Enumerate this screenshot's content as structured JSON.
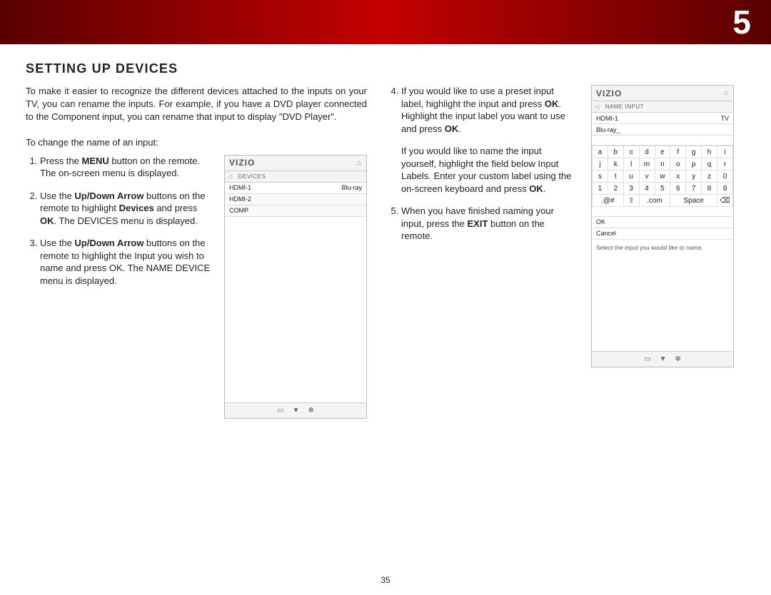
{
  "chapter_number": "5",
  "title": "SETTING UP DEVICES",
  "intro": "To make it easier to recognize the different devices attached to the inputs on your TV, you can rename the inputs. For example, if you have a DVD player connected to the Component input, you can rename that input to display \"DVD Player\".",
  "lead": "To change the name of an input:",
  "steps_left": {
    "s1a": "Press the ",
    "s1b": "MENU",
    "s1c": " button on the remote. The on-screen menu is displayed.",
    "s2a": "Use the ",
    "s2b": "Up/Down Arrow",
    "s2c": " buttons on the remote to highlight ",
    "s2d": "Devices",
    "s2e": " and press ",
    "s2f": "OK",
    "s2g": ". The DEVICES menu is displayed.",
    "s3a": "Use the ",
    "s3b": "Up/Down Arrow",
    "s3c": " buttons on the remote to highlight the Input you wish to name and press OK. The NAME DEVICE menu is displayed."
  },
  "steps_right": {
    "s4a": "If you would like to use a preset input label, highlight the input and press ",
    "s4b": "OK",
    "s4c": ". Highlight the input label you want to use and press ",
    "s4d": "OK",
    "s4e": ".",
    "p1": "If you would like to name the input yourself, highlight the field below Input Labels. Enter your custom label using the on-screen keyboard and press ",
    "p1b": "OK",
    "p1c": ".",
    "s5a": "When you have finished naming your input, press the ",
    "s5b": "EXIT",
    "s5c": " button on the remote."
  },
  "device_panel": {
    "brand": "VIZIO",
    "nav": "DEVICES",
    "rows": [
      {
        "left": "HDMI-1",
        "right": "Blu-ray"
      },
      {
        "left": "HDMI-2",
        "right": ""
      },
      {
        "left": "COMP",
        "right": ""
      }
    ],
    "foot1": "▭",
    "foot2": "▼",
    "foot3": "✻"
  },
  "name_panel": {
    "brand": "VIZIO",
    "nav": "NAME INPUT",
    "rows": [
      {
        "left": "HDMI-1",
        "right": "TV"
      },
      {
        "left": "Blu-ray_",
        "right": ""
      }
    ],
    "kb": {
      "r1": [
        "a",
        "b",
        "c",
        "d",
        "e",
        "f",
        "g",
        "h",
        "i"
      ],
      "r2": [
        "j",
        "k",
        "l",
        "m",
        "n",
        "o",
        "p",
        "q",
        "r"
      ],
      "r3": [
        "s",
        "t",
        "u",
        "v",
        "w",
        "x",
        "y",
        "z",
        "0"
      ],
      "r4": [
        "1",
        "2",
        "3",
        "4",
        "5",
        "6",
        "7",
        "8",
        "9"
      ],
      "sp": [
        ".@#",
        "⇧",
        ".com",
        "Space",
        "⌫"
      ]
    },
    "actions": {
      "ok": "OK",
      "cancel": "Cancel"
    },
    "hint": "Select the input you would like to name.",
    "foot1": "▭",
    "foot2": "▼",
    "foot3": "✻"
  },
  "page_number": "35"
}
